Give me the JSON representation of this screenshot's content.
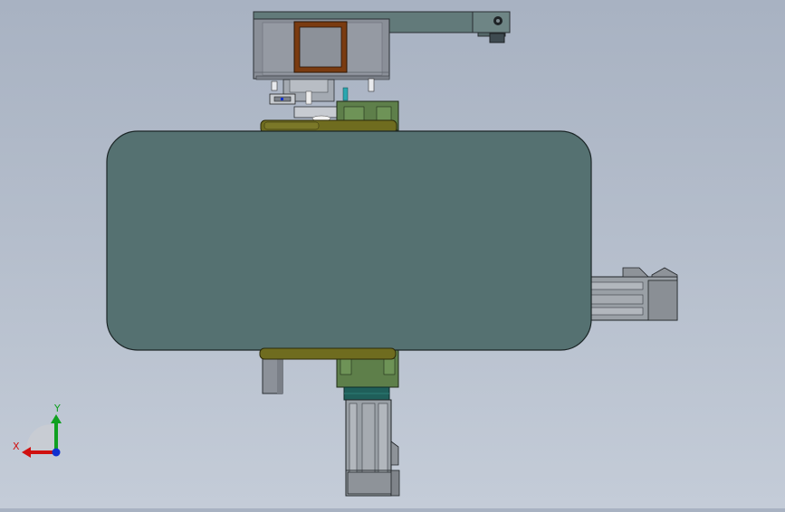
{
  "viewport": {
    "triad": {
      "x_label": "X",
      "y_label": "Y",
      "x_color": "#d01010",
      "y_color": "#10a020",
      "z_color": "#1030d0"
    }
  },
  "colors": {
    "background_top": "#a8b2c2",
    "background_bottom": "#c4ccd8",
    "main_body": "#557171",
    "arm": "#627a7a",
    "housing": "#8a8f98",
    "window_frame": "#7a3b10",
    "olive_plate": "#6f6c1f",
    "green_block": "#5e7f4a",
    "teal_collar": "#1f5f5a",
    "cylinder": "#9aa0a6"
  }
}
